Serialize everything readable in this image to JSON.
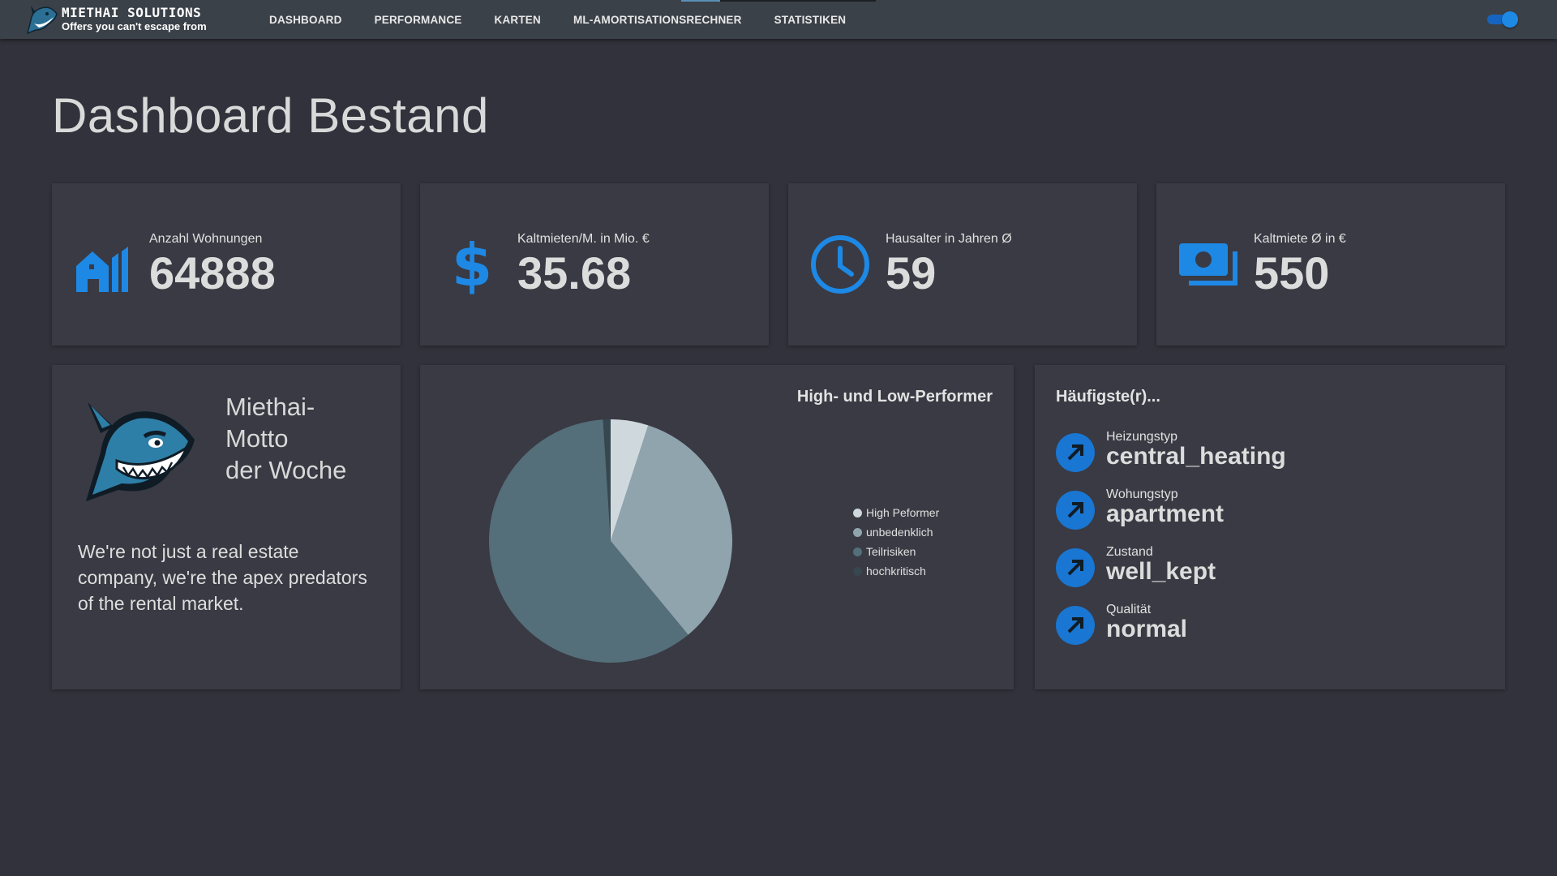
{
  "brand": {
    "name": "MIETHAI SOLUTIONS",
    "tagline": "Offers you can't escape from"
  },
  "nav": {
    "items": [
      "DASHBOARD",
      "PERFORMANCE",
      "KARTEN",
      "ML-AMORTISATIONSRECHNER",
      "STATISTIKEN"
    ]
  },
  "theme_toggle": {
    "on": true
  },
  "page": {
    "title": "Dashboard Bestand"
  },
  "kpis": [
    {
      "label": "Anzahl Wohnungen",
      "value": "64888",
      "icon": "buildings-icon"
    },
    {
      "label": "Kaltmieten/M. in Mio. €",
      "value": "35.68",
      "icon": "dollar-icon"
    },
    {
      "label": "Hausalter in Jahren Ø",
      "value": "59",
      "icon": "clock-icon"
    },
    {
      "label": "Kaltmiete Ø in €",
      "value": "550",
      "icon": "money-icon"
    }
  ],
  "motto": {
    "title_line1": "Miethai-",
    "title_line2": "Motto",
    "title_line3": "der Woche",
    "text": "We're not just a real estate company, we're the apex predators of the rental market."
  },
  "chart_data": {
    "type": "pie",
    "title": "High- und Low-Performer",
    "categories": [
      "High Peformer",
      "unbedenklich",
      "Teilrisiken",
      "hochkritisch"
    ],
    "values": [
      5,
      34,
      60,
      1
    ],
    "colors": [
      "#cfd8dc",
      "#90a4ae",
      "#546e7a",
      "#37474f"
    ],
    "legend_position": "right"
  },
  "frequent": {
    "title": "Häufigste(r)...",
    "items": [
      {
        "label": "Heizungstyp",
        "value": "central_heating"
      },
      {
        "label": "Wohungstyp",
        "value": "apartment"
      },
      {
        "label": "Zustand",
        "value": "well_kept"
      },
      {
        "label": "Qualität",
        "value": "normal"
      }
    ]
  },
  "colors": {
    "accent": "#1976d2",
    "background": "#31323b",
    "card": "#393a43",
    "topbar": "#3b4148"
  }
}
